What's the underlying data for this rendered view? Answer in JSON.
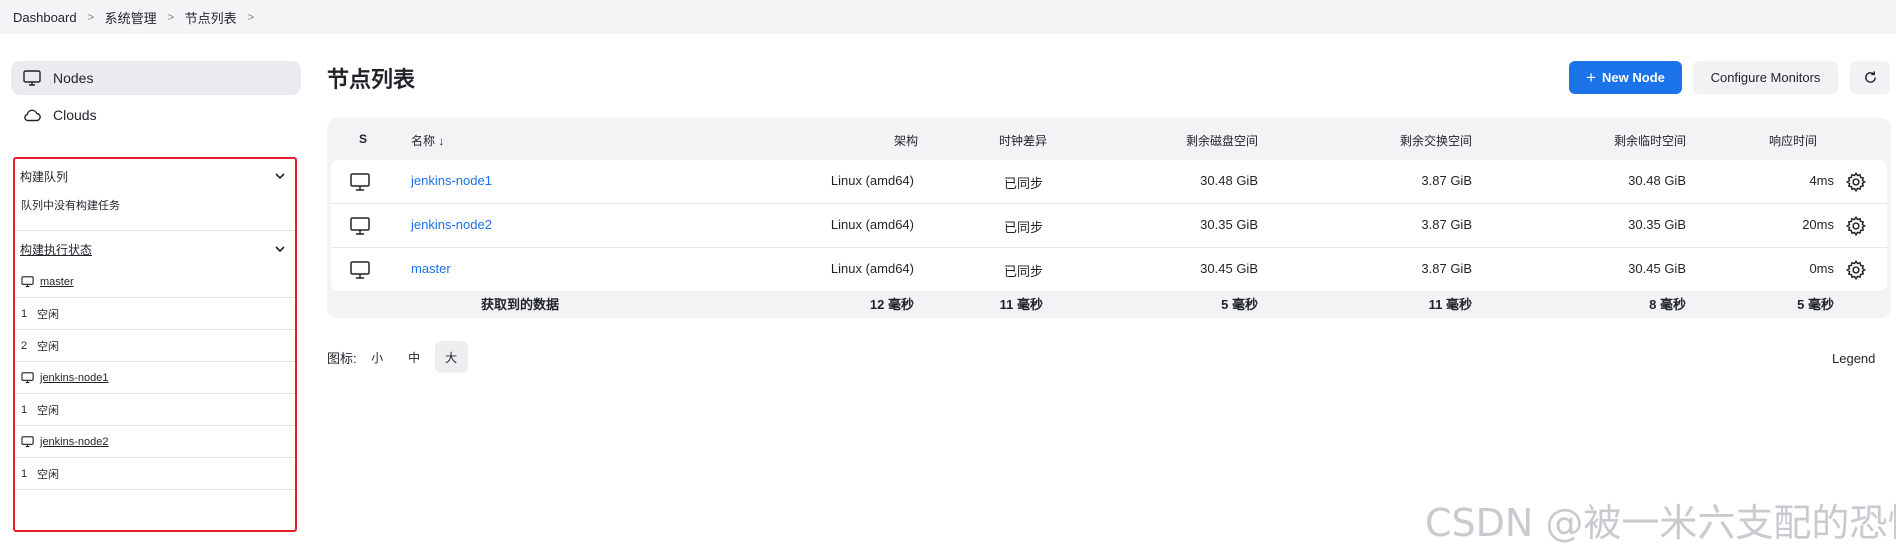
{
  "breadcrumb": [
    "Dashboard",
    "系统管理",
    "节点列表"
  ],
  "sidebar": {
    "tasks": [
      {
        "label": "Nodes",
        "icon": "computer-icon",
        "active": true
      },
      {
        "label": "Clouds",
        "icon": "cloud-icon",
        "active": false
      }
    ],
    "build_queue": {
      "title": "构建队列",
      "empty_text": "队列中没有构建任务"
    },
    "executors": {
      "title": "构建执行状态",
      "nodes": [
        {
          "name": "master",
          "executors": [
            {
              "num": "1",
              "status": "空闲"
            },
            {
              "num": "2",
              "status": "空闲"
            }
          ]
        },
        {
          "name": "jenkins-node1",
          "executors": [
            {
              "num": "1",
              "status": "空闲"
            }
          ]
        },
        {
          "name": "jenkins-node2",
          "executors": [
            {
              "num": "1",
              "status": "空闲"
            }
          ]
        }
      ]
    }
  },
  "header": {
    "title": "节点列表",
    "new_node": "New Node",
    "configure_monitors": "Configure Monitors"
  },
  "table": {
    "columns": [
      "S",
      "名称 ↓",
      "架构",
      "时钟差异",
      "剩余磁盘空间",
      "剩余交换空间",
      "剩余临时空间",
      "响应时间"
    ],
    "rows": [
      {
        "name": "jenkins-node1",
        "arch": "Linux (amd64)",
        "clock": "已同步",
        "disk": "30.48 GiB",
        "swap": "3.87 GiB",
        "temp": "30.48 GiB",
        "resp": "4ms"
      },
      {
        "name": "jenkins-node2",
        "arch": "Linux (amd64)",
        "clock": "已同步",
        "disk": "30.35 GiB",
        "swap": "3.87 GiB",
        "temp": "30.35 GiB",
        "resp": "20ms"
      },
      {
        "name": "master",
        "arch": "Linux (amd64)",
        "clock": "已同步",
        "disk": "30.45 GiB",
        "swap": "3.87 GiB",
        "temp": "30.45 GiB",
        "resp": "0ms"
      }
    ],
    "footer": {
      "label": "获取到的数据",
      "arch": "12 毫秒",
      "clock": "11 毫秒",
      "disk": "5 毫秒",
      "swap": "11 毫秒",
      "temp": "8 毫秒",
      "resp": "5 毫秒"
    }
  },
  "icon_size": {
    "label": "图标:",
    "options": [
      "小",
      "中",
      "大"
    ],
    "selected": "大"
  },
  "legend": "Legend",
  "watermark": "CSDN @被一米六支配的恐惧",
  "colors": {
    "accent": "#1a73e8",
    "highlight_border": "#e6202b"
  }
}
